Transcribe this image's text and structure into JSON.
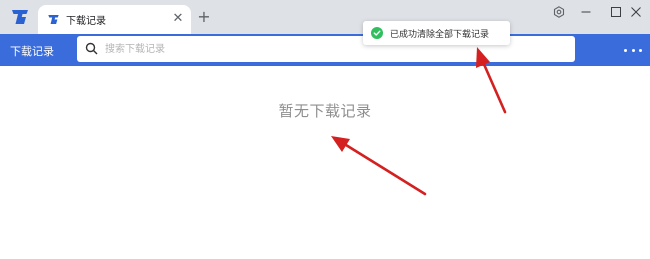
{
  "tab": {
    "title": "下载记录"
  },
  "header": {
    "title": "下载记录",
    "search_placeholder": "搜索下载记录"
  },
  "main": {
    "empty_message": "暂无下载记录"
  },
  "toast": {
    "message": "已成功清除全部下载记录"
  },
  "icons": {
    "app_logo": "app-logo",
    "tab_favicon": "app-logo",
    "tab_close": "close-icon",
    "new_tab": "plus-icon",
    "settings": "settings-icon",
    "minimize": "minimize-icon",
    "maximize": "maximize-icon",
    "close": "close-icon",
    "search": "search-icon",
    "more": "more-icon",
    "toast": "check-circle-icon"
  },
  "colors": {
    "brand_blue": "#3a6ddb",
    "titlebar": "#dee1e6",
    "success_green": "#2fbf5f",
    "annotation_red": "#d42020",
    "empty_text": "#8f8f8f"
  }
}
